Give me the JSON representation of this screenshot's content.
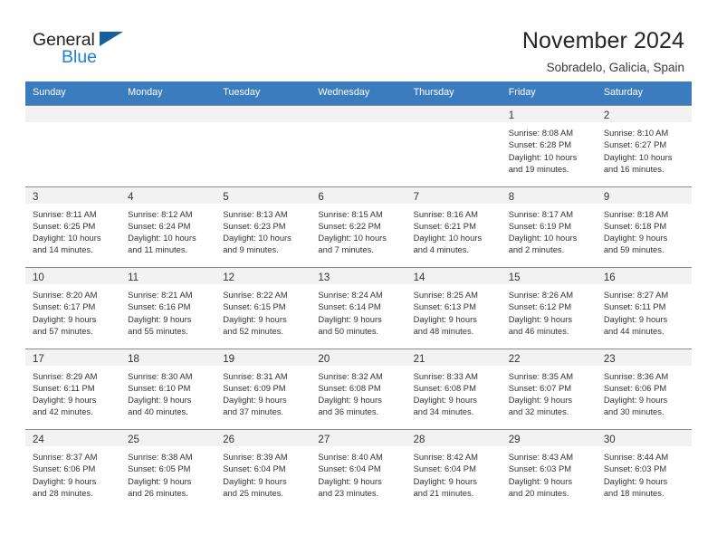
{
  "brand": {
    "name_part1": "General",
    "name_part2": "Blue",
    "triangle_icon": "triangle-icon",
    "accent_color": "#1b7fd4",
    "triangle_color": "#15619f"
  },
  "header": {
    "title": "November 2024",
    "subtitle": "Sobradelo, Galicia, Spain"
  },
  "calendar": {
    "header_bg": "#3a7cbe",
    "day_band_bg": "#f2f2f2",
    "weekdays": [
      "Sunday",
      "Monday",
      "Tuesday",
      "Wednesday",
      "Thursday",
      "Friday",
      "Saturday"
    ],
    "weeks": [
      [
        {
          "day": "",
          "sunrise": "",
          "sunset": "",
          "daylight_1": "",
          "daylight_2": ""
        },
        {
          "day": "",
          "sunrise": "",
          "sunset": "",
          "daylight_1": "",
          "daylight_2": ""
        },
        {
          "day": "",
          "sunrise": "",
          "sunset": "",
          "daylight_1": "",
          "daylight_2": ""
        },
        {
          "day": "",
          "sunrise": "",
          "sunset": "",
          "daylight_1": "",
          "daylight_2": ""
        },
        {
          "day": "",
          "sunrise": "",
          "sunset": "",
          "daylight_1": "",
          "daylight_2": ""
        },
        {
          "day": "1",
          "sunrise": "Sunrise: 8:08 AM",
          "sunset": "Sunset: 6:28 PM",
          "daylight_1": "Daylight: 10 hours",
          "daylight_2": "and 19 minutes."
        },
        {
          "day": "2",
          "sunrise": "Sunrise: 8:10 AM",
          "sunset": "Sunset: 6:27 PM",
          "daylight_1": "Daylight: 10 hours",
          "daylight_2": "and 16 minutes."
        }
      ],
      [
        {
          "day": "3",
          "sunrise": "Sunrise: 8:11 AM",
          "sunset": "Sunset: 6:25 PM",
          "daylight_1": "Daylight: 10 hours",
          "daylight_2": "and 14 minutes."
        },
        {
          "day": "4",
          "sunrise": "Sunrise: 8:12 AM",
          "sunset": "Sunset: 6:24 PM",
          "daylight_1": "Daylight: 10 hours",
          "daylight_2": "and 11 minutes."
        },
        {
          "day": "5",
          "sunrise": "Sunrise: 8:13 AM",
          "sunset": "Sunset: 6:23 PM",
          "daylight_1": "Daylight: 10 hours",
          "daylight_2": "and 9 minutes."
        },
        {
          "day": "6",
          "sunrise": "Sunrise: 8:15 AM",
          "sunset": "Sunset: 6:22 PM",
          "daylight_1": "Daylight: 10 hours",
          "daylight_2": "and 7 minutes."
        },
        {
          "day": "7",
          "sunrise": "Sunrise: 8:16 AM",
          "sunset": "Sunset: 6:21 PM",
          "daylight_1": "Daylight: 10 hours",
          "daylight_2": "and 4 minutes."
        },
        {
          "day": "8",
          "sunrise": "Sunrise: 8:17 AM",
          "sunset": "Sunset: 6:19 PM",
          "daylight_1": "Daylight: 10 hours",
          "daylight_2": "and 2 minutes."
        },
        {
          "day": "9",
          "sunrise": "Sunrise: 8:18 AM",
          "sunset": "Sunset: 6:18 PM",
          "daylight_1": "Daylight: 9 hours",
          "daylight_2": "and 59 minutes."
        }
      ],
      [
        {
          "day": "10",
          "sunrise": "Sunrise: 8:20 AM",
          "sunset": "Sunset: 6:17 PM",
          "daylight_1": "Daylight: 9 hours",
          "daylight_2": "and 57 minutes."
        },
        {
          "day": "11",
          "sunrise": "Sunrise: 8:21 AM",
          "sunset": "Sunset: 6:16 PM",
          "daylight_1": "Daylight: 9 hours",
          "daylight_2": "and 55 minutes."
        },
        {
          "day": "12",
          "sunrise": "Sunrise: 8:22 AM",
          "sunset": "Sunset: 6:15 PM",
          "daylight_1": "Daylight: 9 hours",
          "daylight_2": "and 52 minutes."
        },
        {
          "day": "13",
          "sunrise": "Sunrise: 8:24 AM",
          "sunset": "Sunset: 6:14 PM",
          "daylight_1": "Daylight: 9 hours",
          "daylight_2": "and 50 minutes."
        },
        {
          "day": "14",
          "sunrise": "Sunrise: 8:25 AM",
          "sunset": "Sunset: 6:13 PM",
          "daylight_1": "Daylight: 9 hours",
          "daylight_2": "and 48 minutes."
        },
        {
          "day": "15",
          "sunrise": "Sunrise: 8:26 AM",
          "sunset": "Sunset: 6:12 PM",
          "daylight_1": "Daylight: 9 hours",
          "daylight_2": "and 46 minutes."
        },
        {
          "day": "16",
          "sunrise": "Sunrise: 8:27 AM",
          "sunset": "Sunset: 6:11 PM",
          "daylight_1": "Daylight: 9 hours",
          "daylight_2": "and 44 minutes."
        }
      ],
      [
        {
          "day": "17",
          "sunrise": "Sunrise: 8:29 AM",
          "sunset": "Sunset: 6:11 PM",
          "daylight_1": "Daylight: 9 hours",
          "daylight_2": "and 42 minutes."
        },
        {
          "day": "18",
          "sunrise": "Sunrise: 8:30 AM",
          "sunset": "Sunset: 6:10 PM",
          "daylight_1": "Daylight: 9 hours",
          "daylight_2": "and 40 minutes."
        },
        {
          "day": "19",
          "sunrise": "Sunrise: 8:31 AM",
          "sunset": "Sunset: 6:09 PM",
          "daylight_1": "Daylight: 9 hours",
          "daylight_2": "and 37 minutes."
        },
        {
          "day": "20",
          "sunrise": "Sunrise: 8:32 AM",
          "sunset": "Sunset: 6:08 PM",
          "daylight_1": "Daylight: 9 hours",
          "daylight_2": "and 36 minutes."
        },
        {
          "day": "21",
          "sunrise": "Sunrise: 8:33 AM",
          "sunset": "Sunset: 6:08 PM",
          "daylight_1": "Daylight: 9 hours",
          "daylight_2": "and 34 minutes."
        },
        {
          "day": "22",
          "sunrise": "Sunrise: 8:35 AM",
          "sunset": "Sunset: 6:07 PM",
          "daylight_1": "Daylight: 9 hours",
          "daylight_2": "and 32 minutes."
        },
        {
          "day": "23",
          "sunrise": "Sunrise: 8:36 AM",
          "sunset": "Sunset: 6:06 PM",
          "daylight_1": "Daylight: 9 hours",
          "daylight_2": "and 30 minutes."
        }
      ],
      [
        {
          "day": "24",
          "sunrise": "Sunrise: 8:37 AM",
          "sunset": "Sunset: 6:06 PM",
          "daylight_1": "Daylight: 9 hours",
          "daylight_2": "and 28 minutes."
        },
        {
          "day": "25",
          "sunrise": "Sunrise: 8:38 AM",
          "sunset": "Sunset: 6:05 PM",
          "daylight_1": "Daylight: 9 hours",
          "daylight_2": "and 26 minutes."
        },
        {
          "day": "26",
          "sunrise": "Sunrise: 8:39 AM",
          "sunset": "Sunset: 6:04 PM",
          "daylight_1": "Daylight: 9 hours",
          "daylight_2": "and 25 minutes."
        },
        {
          "day": "27",
          "sunrise": "Sunrise: 8:40 AM",
          "sunset": "Sunset: 6:04 PM",
          "daylight_1": "Daylight: 9 hours",
          "daylight_2": "and 23 minutes."
        },
        {
          "day": "28",
          "sunrise": "Sunrise: 8:42 AM",
          "sunset": "Sunset: 6:04 PM",
          "daylight_1": "Daylight: 9 hours",
          "daylight_2": "and 21 minutes."
        },
        {
          "day": "29",
          "sunrise": "Sunrise: 8:43 AM",
          "sunset": "Sunset: 6:03 PM",
          "daylight_1": "Daylight: 9 hours",
          "daylight_2": "and 20 minutes."
        },
        {
          "day": "30",
          "sunrise": "Sunrise: 8:44 AM",
          "sunset": "Sunset: 6:03 PM",
          "daylight_1": "Daylight: 9 hours",
          "daylight_2": "and 18 minutes."
        }
      ]
    ]
  }
}
